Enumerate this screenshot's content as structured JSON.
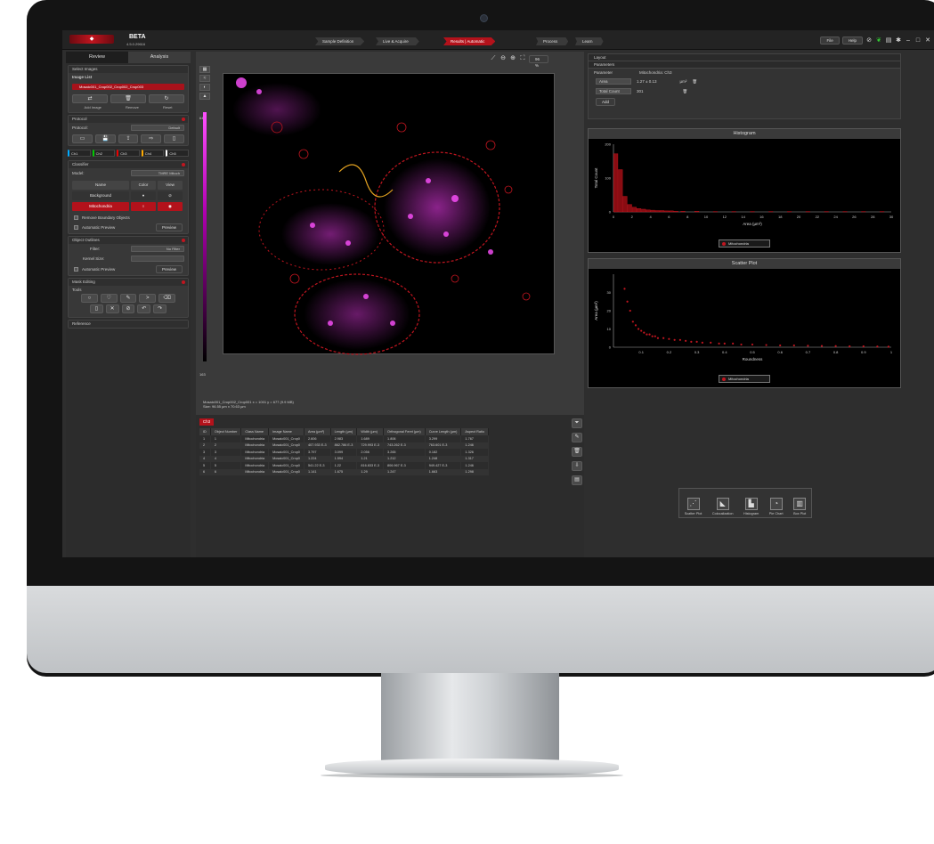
{
  "app": {
    "beta": "BETA",
    "version": "4.5.0.29616"
  },
  "workflow": [
    {
      "label": "Sample Definition",
      "active": false
    },
    {
      "label": "Live & Acquire",
      "active": false
    },
    {
      "label": "Results | Automatic",
      "active": true
    },
    {
      "label": "Process",
      "active": false
    },
    {
      "label": "Learn",
      "active": false
    }
  ],
  "menu": {
    "file": "File",
    "help": "Help"
  },
  "left": {
    "tab_review": "Review",
    "tab_analysis": "Analysis",
    "select_images": "Select Images",
    "image_list": "Image List",
    "image_name": "Mosaic001_Crop002_Crop002_Crop003",
    "add_image": "Add Image",
    "remove": "Remove",
    "reset": "Reset",
    "protocol_header": "Protocol",
    "protocol_label": "Protocol:",
    "protocol_value": "Default",
    "channels": [
      "Ch1",
      "Ch2",
      "Ch3",
      "Ch4",
      "Ch5"
    ],
    "classifier_header": "Classifier",
    "model_label": "Model:",
    "model_value": "TMRE Mitoch",
    "col_name": "Name",
    "col_color": "Color",
    "col_view": "View",
    "class_bg": "Background",
    "class_mito": "Mitochondria",
    "remove_boundary": "Remove Boundary Objects",
    "auto_preview": "Automatic Preview",
    "preview": "Preview",
    "outlines_header": "Object Outlines",
    "filter_label": "Filter:",
    "filter_value": "No Filter",
    "kernel_label": "Kernel Size:",
    "auto_preview2": "Automatic Preview",
    "preview2": "Preview",
    "mask_header": "Mask Editing",
    "tools": "Tools",
    "reference": "Reference"
  },
  "viewer": {
    "zoom": "96 %",
    "scale_top": "640",
    "scale_bottom": "163",
    "info_line1": "Mosaic001_Crop002_Crop001  x = 1001 y = 677  (9.9 MB)",
    "info_line2": "Size: 96.55 µm x 70.63 µm"
  },
  "viewer_channels": [
    "Ch1",
    "Ch2",
    "Ch3",
    "Ch4",
    "Ch5",
    "3D"
  ],
  "table": {
    "tab": "Ch3",
    "columns": [
      "ID",
      "Object Number",
      "Class Name",
      "Image Name",
      "Area (µm²)",
      "Length (µm)",
      "Width (µm)",
      "Orthogonal Feret (µm)",
      "Curve Length (µm)",
      "Aspect Ratio"
    ],
    "rows": [
      [
        "1",
        "1",
        "Mitochondria",
        "Mosaic001_Crop0",
        "2.606",
        "2.983",
        "1.689",
        "1.806",
        "3.299",
        "1.767"
      ],
      [
        "2",
        "2",
        "Mitochondria",
        "Mosaic001_Crop0",
        "407.933 E-3",
        "862.786 E-3",
        "729.993 E-3",
        "743.262 E-3",
        "763.601 E-3",
        "1.246"
      ],
      [
        "3",
        "3",
        "Mitochondria",
        "Mosaic001_Crop0",
        "3.797",
        "3.099",
        "2.056",
        "3.265",
        "0.182",
        "1.326"
      ],
      [
        "4",
        "4",
        "Mitochondria",
        "Mosaic001_Crop0",
        "1.224",
        "1.594",
        "1.21",
        "1.212",
        "1.248",
        "1.317"
      ],
      [
        "5",
        "5",
        "Mitochondria",
        "Mosaic001_Crop0",
        "541.22 E-3",
        "1.22",
        "816.833 E-3",
        "806.967 E-3",
        "949.427 E-3",
        "1.246"
      ],
      [
        "6",
        "6",
        "Mitochondria",
        "Mosaic001_Crop0",
        "1.141",
        "1.675",
        "1.29",
        "1.247",
        "1.663",
        "1.298"
      ]
    ]
  },
  "right": {
    "layout": "Layout",
    "parameters": "Parameters",
    "param_label": "Parameter",
    "param_value": "Mitochondria: Ch3",
    "area_label": "Area",
    "area_value": "1.27 ± 0.13",
    "area_unit": "µm²",
    "count_label": "Total Count",
    "count_value": "301",
    "add": "Add"
  },
  "histogram": {
    "title": "Histogram",
    "ylabel": "Total Count",
    "xlabel": "Area (µm²)",
    "legend": "Mitochondria"
  },
  "scatter": {
    "title": "Scatter Plot",
    "ylabel": "Area (µm²)",
    "xlabel": "Roundness",
    "legend": "Mitochondria"
  },
  "chart_tools": [
    "Scatter Plot",
    "Colocalization",
    "Histogram",
    "Pie Chart",
    "Box Plot"
  ],
  "chart_data": [
    {
      "type": "bar",
      "title": "Histogram",
      "xlabel": "Area (µm²)",
      "ylabel": "Total Count",
      "xlim": [
        0,
        30
      ],
      "ylim": [
        0,
        200
      ],
      "x": [
        0.25,
        0.75,
        1.25,
        1.75,
        2.25,
        2.75,
        3.25,
        3.75,
        4.25,
        4.75,
        5.25,
        5.75,
        6.25,
        6.75,
        7.5,
        9,
        11,
        13,
        15,
        17,
        19,
        21,
        23,
        25,
        27,
        29
      ],
      "values": [
        172,
        125,
        46,
        22,
        14,
        10,
        8,
        6,
        5,
        4,
        4,
        3,
        3,
        2,
        2,
        2,
        1,
        1,
        1,
        1,
        1,
        1,
        1,
        1,
        1,
        1
      ],
      "series": [
        {
          "name": "Mitochondria",
          "values": [
            172,
            125,
            46,
            22,
            14,
            10,
            8,
            6,
            5,
            4,
            4,
            3,
            3,
            2,
            2,
            2,
            1,
            1,
            1,
            1,
            1,
            1,
            1,
            1,
            1,
            1
          ]
        }
      ]
    },
    {
      "type": "scatter",
      "title": "Scatter Plot",
      "xlabel": "Roundness",
      "ylabel": "Area (µm²)",
      "xlim": [
        0,
        1
      ],
      "ylim": [
        0,
        40
      ],
      "series": [
        {
          "name": "Mitochondria",
          "x": [
            0.04,
            0.05,
            0.06,
            0.07,
            0.08,
            0.09,
            0.1,
            0.11,
            0.12,
            0.13,
            0.14,
            0.15,
            0.16,
            0.18,
            0.2,
            0.22,
            0.24,
            0.26,
            0.28,
            0.3,
            0.32,
            0.35,
            0.38,
            0.4,
            0.43,
            0.46,
            0.5,
            0.55,
            0.6,
            0.65,
            0.7,
            0.75,
            0.8,
            0.85,
            0.9,
            0.95,
            0.99
          ],
          "y": [
            32,
            25,
            20,
            14,
            12,
            10,
            9,
            8,
            7,
            7,
            6,
            6,
            5,
            5,
            4.5,
            4,
            4,
            3.5,
            3,
            3,
            2.5,
            2.5,
            2,
            2,
            2,
            1.5,
            1.5,
            1.2,
            1,
            1,
            0.8,
            0.7,
            0.6,
            0.5,
            0.5,
            0.4,
            0.3
          ]
        }
      ]
    }
  ],
  "colors": {
    "accent": "#b3121b",
    "magenta": "#e020e0"
  }
}
